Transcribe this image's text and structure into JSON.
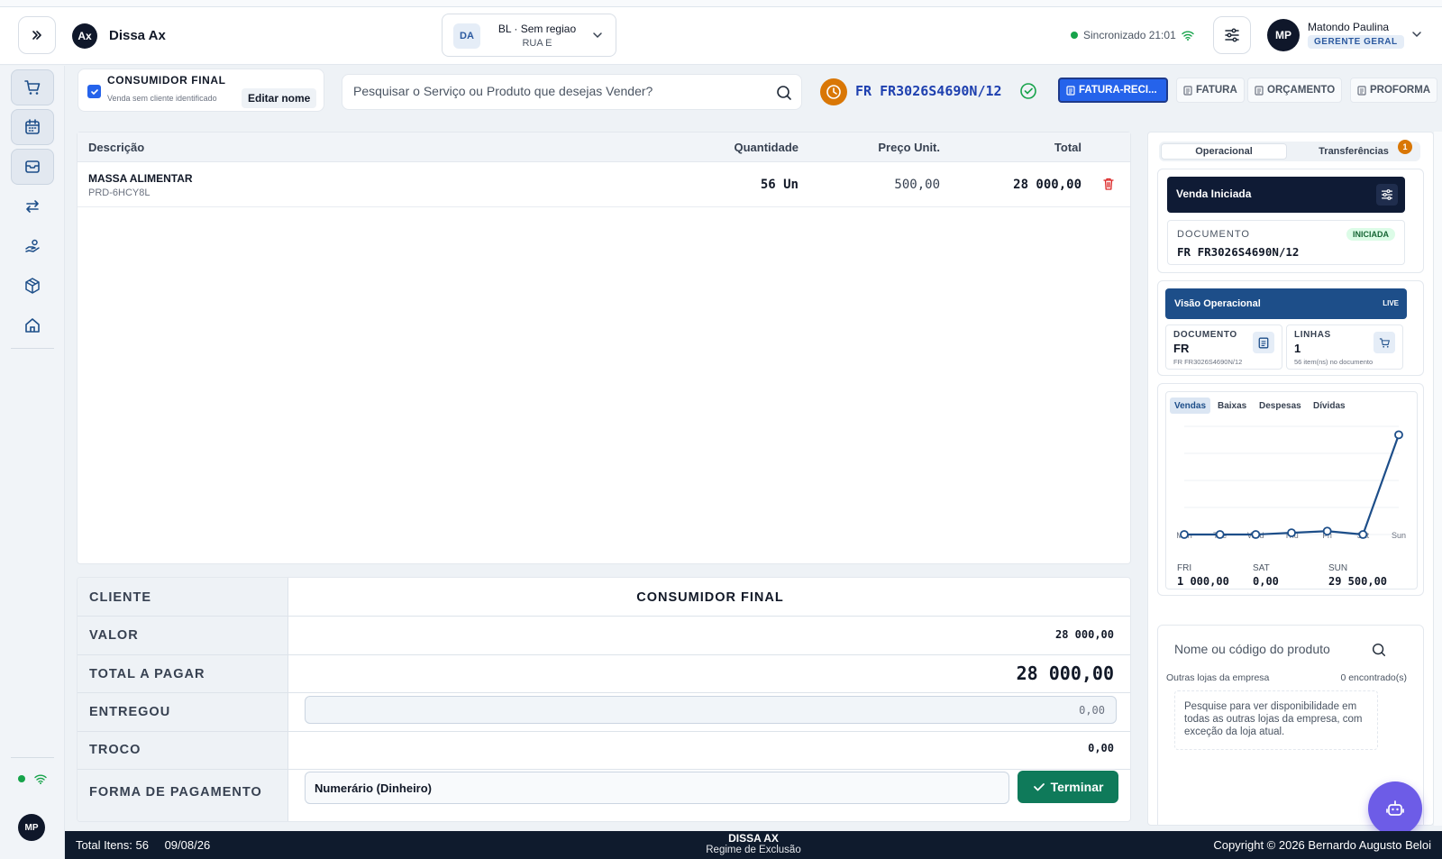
{
  "header": {
    "app_name": "Dissa Ax",
    "logo_text": "Ax",
    "store": {
      "badge": "DA",
      "name": "BL · Sem regiao",
      "sub": "RUA E"
    },
    "sync_status": "Sincronizado 21:01",
    "user": {
      "initials": "MP",
      "name": "Matondo Paulina",
      "role": "GERENTE GERAL"
    }
  },
  "sidebar": {
    "items": [
      {
        "icon": "cart-icon",
        "active": true
      },
      {
        "icon": "calendar-icon",
        "active": true
      },
      {
        "icon": "inbox-icon",
        "active": true
      },
      {
        "icon": "transfer-icon",
        "active": false
      },
      {
        "icon": "hand-coins-icon",
        "active": false
      },
      {
        "icon": "package-icon",
        "active": false
      },
      {
        "icon": "home-icon",
        "active": false
      }
    ],
    "avatar_initials": "MP"
  },
  "client": {
    "title": "CONSUMIDOR FINAL",
    "subtitle": "Venda sem cliente identificado",
    "edit_label": "Editar nome"
  },
  "search": {
    "placeholder": "Pesquisar o Serviço ou Produto que desejas Vender?"
  },
  "document": {
    "number": "FR  FR3026S4690N/12",
    "tabs": [
      {
        "label": "FATURA-RECI...",
        "active": true
      },
      {
        "label": "FATURA",
        "active": false
      },
      {
        "label": "ORÇAMENTO",
        "active": false
      },
      {
        "label": "PROFORMA",
        "active": false
      }
    ]
  },
  "items_table": {
    "columns": [
      "Descrição",
      "Quantidade",
      "Preço Unit.",
      "Total"
    ],
    "rows": [
      {
        "name": "MASSA ALIMENTAR",
        "code": "PRD-6HCY8L",
        "quantity": "56 Un",
        "unit_price": "500,00",
        "total": "28 000,00"
      }
    ]
  },
  "summary": {
    "labels": {
      "cliente": "CLIENTE",
      "valor": "VALOR",
      "total": "TOTAL A PAGAR",
      "entregou": "ENTREGOU",
      "troco": "TROCO",
      "pagamento": "FORMA DE PAGAMENTO"
    },
    "client_name": "CONSUMIDOR FINAL",
    "valor": "28 000,00",
    "total_a_pagar": "28 000,00",
    "entregou_placeholder": "0,00",
    "troco": "0,00",
    "payment_method": "Numerário (Dinheiro)",
    "finish_label": "Terminar"
  },
  "right_panel": {
    "tabs": [
      {
        "label": "Operacional",
        "active": true
      },
      {
        "label": "Transferências",
        "active": false
      }
    ],
    "transfer_badge": "1",
    "sale_status": "Venda Iniciada",
    "doc_label": "DOCUMENTO",
    "doc_number": "FR  FR3026S4690N/12",
    "doc_state": "INICIADA",
    "ops_title": "Visão Operacional",
    "live_label": "LIVE",
    "doc_box": {
      "label": "DOCUMENTO",
      "value": "FR",
      "sub": "FR FR3026S4690N/12"
    },
    "lines_box": {
      "label": "LINHAS",
      "value": "1",
      "sub": "56 item(ns) no documento"
    },
    "chart_tabs": [
      {
        "label": "Vendas",
        "active": true
      },
      {
        "label": "Baixas",
        "active": false
      },
      {
        "label": "Despesas",
        "active": false
      },
      {
        "label": "Dívidas",
        "active": false
      }
    ],
    "stats": [
      {
        "day": "FRI",
        "value": "1 000,00"
      },
      {
        "day": "SAT",
        "value": "0,00"
      },
      {
        "day": "SUN",
        "value": "29 500,00"
      }
    ],
    "lookup": {
      "placeholder": "Nome ou código do produto",
      "other_stores": "Outras lojas da empresa",
      "found": "0 encontrado(s)",
      "note": "Pesquise para ver disponibilidade em todas as outras lojas da empresa, com exceção da loja atual."
    }
  },
  "chart_data": {
    "type": "line",
    "categories": [
      "Mon",
      "Tue",
      "Wed",
      "Thu",
      "Fri",
      "Sat",
      "Sun"
    ],
    "series": [
      {
        "values": [
          0,
          0,
          0,
          500,
          1000,
          0,
          29500
        ]
      }
    ],
    "ylim": [
      0,
      32000
    ],
    "grid": true,
    "color": "#1d4e89"
  },
  "footer": {
    "total_items": "Total Itens: 56",
    "date": "09/08/26",
    "brand": "DISSA AX",
    "mode": "Regime de Exclusão",
    "copyright": "Copyright © 2026 Bernardo Augusto Beloi"
  }
}
